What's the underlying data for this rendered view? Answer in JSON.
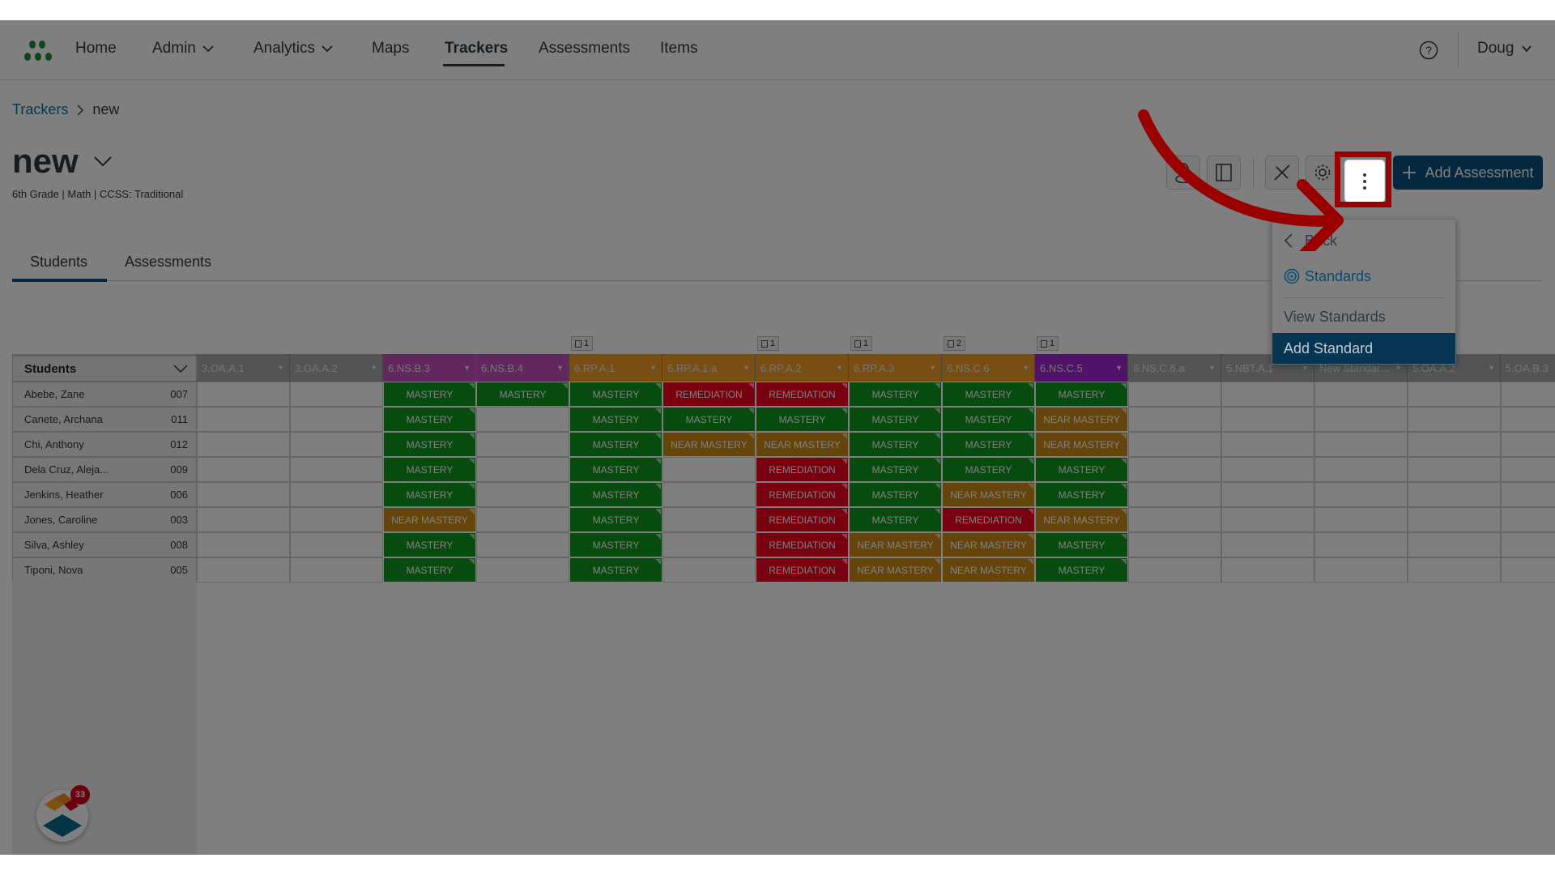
{
  "nav": {
    "items": [
      {
        "label": "Home",
        "dropdown": false
      },
      {
        "label": "Admin",
        "dropdown": true
      },
      {
        "label": "Analytics",
        "dropdown": true
      },
      {
        "label": "Maps",
        "dropdown": false
      },
      {
        "label": "Trackers",
        "dropdown": false,
        "active": true
      },
      {
        "label": "Assessments",
        "dropdown": false
      },
      {
        "label": "Items",
        "dropdown": false
      }
    ],
    "user": "Doug",
    "help_icon": "question-circle-icon"
  },
  "breadcrumb": {
    "parent": "Trackers",
    "current": "new"
  },
  "page": {
    "title": "new",
    "meta": "6th Grade  |  Math  |  CCSS: Traditional"
  },
  "toolbar": {
    "buttons": [
      "student-icon",
      "panel-icon",
      "tools-icon",
      "gear-icon",
      "more-vertical-icon"
    ],
    "add_label": "Add Assessment"
  },
  "tabs": [
    {
      "label": "Students",
      "active": true
    },
    {
      "label": "Assessments",
      "active": false
    }
  ],
  "menu": {
    "back": "Back",
    "section": "Standards",
    "items": [
      "View Standards",
      "Add Standard"
    ],
    "active_item": "Add Standard"
  },
  "grid": {
    "students_header": "Students",
    "standards": [
      {
        "code": "3.OA.A.1",
        "color": "#a9a9a9",
        "count": null
      },
      {
        "code": "3.OA.A.2",
        "color": "#a9a9a9",
        "count": null
      },
      {
        "code": "6.NS.B.3",
        "color": "#c74fc1",
        "count": null
      },
      {
        "code": "6.NS.B.4",
        "color": "#c74fc1",
        "count": null
      },
      {
        "code": "6.RP.A.1",
        "color": "#f39c27",
        "count": "1"
      },
      {
        "code": "6.RP.A.1.a",
        "color": "#f39c27",
        "count": null
      },
      {
        "code": "6.RP.A.2",
        "color": "#f39c27",
        "count": "1"
      },
      {
        "code": "6.RP.A.3",
        "color": "#f39c27",
        "count": "1"
      },
      {
        "code": "6.NS.C.6",
        "color": "#f39c27",
        "count": "2"
      },
      {
        "code": "6.NS.C.5",
        "color": "#a225d8",
        "count": "1"
      },
      {
        "code": "6.NS.C.6.a",
        "color": "#a9a9a9",
        "count": null
      },
      {
        "code": "5.NBT.A.1",
        "color": "#a9a9a9",
        "count": null
      },
      {
        "code": "New Standar...",
        "color": "#a9a9a9",
        "count": null
      },
      {
        "code": "5.OA.A.2",
        "color": "#a9a9a9",
        "count": null
      },
      {
        "code": "5.OA.B.3",
        "color": "#a9a9a9",
        "count": null
      }
    ],
    "status_colors": {
      "MASTERY": "#11971f",
      "NEAR MASTERY": "#cd8a1a",
      "REMEDIATION": "#f0001f"
    },
    "students": [
      {
        "name": "Abebe, Zane",
        "id": "007",
        "scores": [
          "",
          "",
          "MASTERY",
          "MASTERY",
          "MASTERY",
          "REMEDIATION",
          "REMEDIATION",
          "MASTERY",
          "MASTERY",
          "MASTERY",
          "",
          "",
          "",
          "",
          ""
        ]
      },
      {
        "name": "Canete, Archana",
        "id": "011",
        "scores": [
          "",
          "",
          "MASTERY",
          "",
          "MASTERY",
          "MASTERY",
          "MASTERY",
          "MASTERY",
          "MASTERY",
          "NEAR MASTERY",
          "",
          "",
          "",
          "",
          ""
        ]
      },
      {
        "name": "Chi, Anthony",
        "id": "012",
        "scores": [
          "",
          "",
          "MASTERY",
          "",
          "MASTERY",
          "NEAR MASTERY",
          "NEAR MASTERY",
          "MASTERY",
          "MASTERY",
          "NEAR MASTERY",
          "",
          "",
          "",
          "",
          ""
        ]
      },
      {
        "name": "Dela Cruz, Aleja...",
        "id": "009",
        "scores": [
          "",
          "",
          "MASTERY",
          "",
          "MASTERY",
          "",
          "REMEDIATION",
          "MASTERY",
          "MASTERY",
          "MASTERY",
          "",
          "",
          "",
          "",
          ""
        ]
      },
      {
        "name": "Jenkins, Heather",
        "id": "006",
        "scores": [
          "",
          "",
          "MASTERY",
          "",
          "MASTERY",
          "",
          "REMEDIATION",
          "MASTERY",
          "NEAR MASTERY",
          "MASTERY",
          "",
          "",
          "",
          "",
          ""
        ]
      },
      {
        "name": "Jones, Caroline",
        "id": "003",
        "scores": [
          "",
          "",
          "NEAR MASTERY",
          "",
          "MASTERY",
          "",
          "REMEDIATION",
          "MASTERY",
          "REMEDIATION",
          "NEAR MASTERY",
          "",
          "",
          "",
          "",
          ""
        ]
      },
      {
        "name": "Silva, Ashley",
        "id": "008",
        "scores": [
          "",
          "",
          "MASTERY",
          "",
          "MASTERY",
          "",
          "REMEDIATION",
          "NEAR MASTERY",
          "NEAR MASTERY",
          "MASTERY",
          "",
          "",
          "",
          "",
          ""
        ]
      },
      {
        "name": "Tiponi, Nova",
        "id": "005",
        "scores": [
          "",
          "",
          "MASTERY",
          "",
          "MASTERY",
          "",
          "REMEDIATION",
          "NEAR MASTERY",
          "NEAR MASTERY",
          "MASTERY",
          "",
          "",
          "",
          "",
          ""
        ]
      }
    ]
  },
  "widget": {
    "badge": "33"
  },
  "annotation": {
    "color": "#9b0000"
  }
}
